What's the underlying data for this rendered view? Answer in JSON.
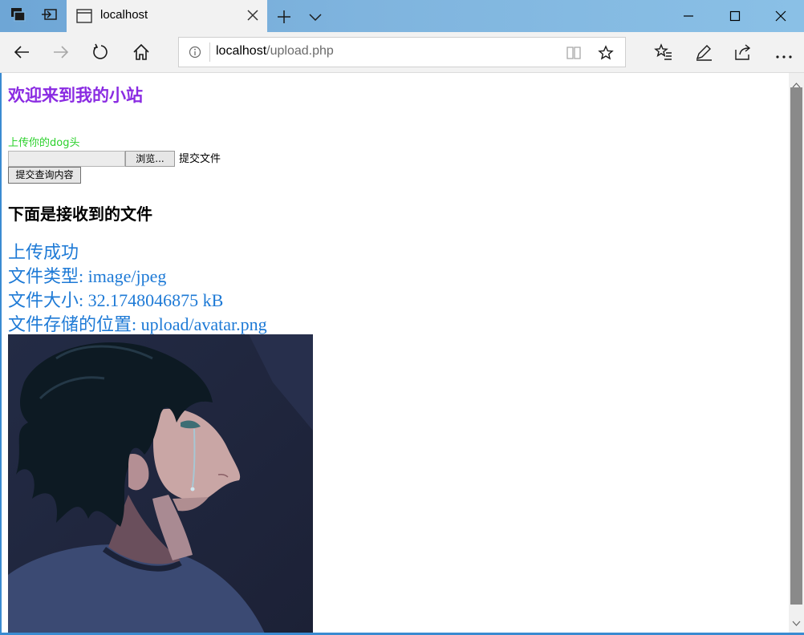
{
  "browser": {
    "tab_title": "localhost",
    "address_host": "localhost",
    "address_path": "/upload.php"
  },
  "page": {
    "welcome": "欢迎来到我的小站",
    "upload_label": "上传你的dog头",
    "browse_button": "浏览...",
    "submit_file_label": "提交文件",
    "query_button": "提交查询内容",
    "received_heading": "下面是接收到的文件",
    "results": [
      "上传成功",
      "文件类型: image/jpeg",
      "文件大小: 32.1748046875 kB",
      "文件存储的位置: upload/avatar.png"
    ]
  },
  "icons": {
    "tab_icon": "browser-page-icon",
    "back": "back-arrow-icon",
    "forward": "forward-arrow-icon",
    "refresh": "refresh-icon",
    "home": "home-icon"
  },
  "colors": {
    "welcome": "#8a2be2",
    "upload_label": "#2bd12b",
    "result_text": "#1e7ad6"
  }
}
